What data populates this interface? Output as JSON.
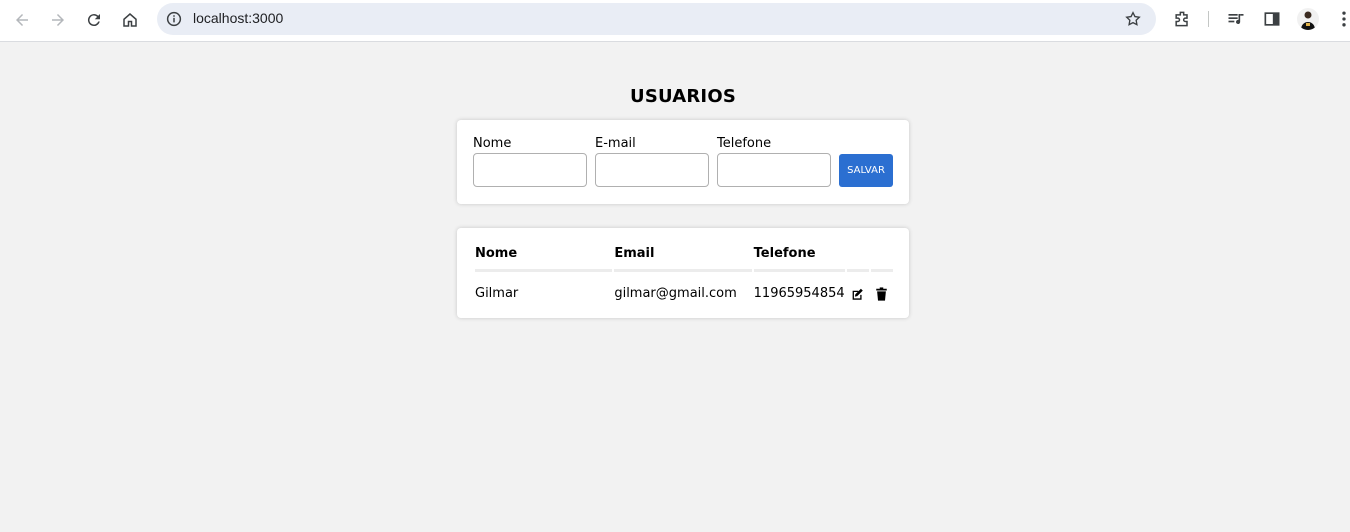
{
  "browser": {
    "url": "localhost:3000",
    "icons": [
      "back-icon",
      "forward-icon",
      "reload-icon",
      "home-icon",
      "info-icon",
      "bookmark-star-icon",
      "extensions-icon",
      "media-icon",
      "side-panel-icon",
      "profile-avatar",
      "kebab-menu-icon"
    ]
  },
  "page": {
    "title": "USUARIOS"
  },
  "form": {
    "nome_label": "Nome",
    "email_label": "E-mail",
    "telefone_label": "Telefone",
    "nome_value": "",
    "email_value": "",
    "telefone_value": "",
    "save_label": "SALVAR"
  },
  "table": {
    "headers": [
      "Nome",
      "Email",
      "Telefone"
    ],
    "rows": [
      {
        "nome": "Gilmar",
        "email": "gilmar@gmail.com",
        "telefone": "11965954854",
        "actions": [
          "edit-icon",
          "trash-icon"
        ]
      }
    ]
  },
  "colors": {
    "accent": "#2b6fd1",
    "background": "#f2f2f2",
    "card": "#ffffff"
  }
}
